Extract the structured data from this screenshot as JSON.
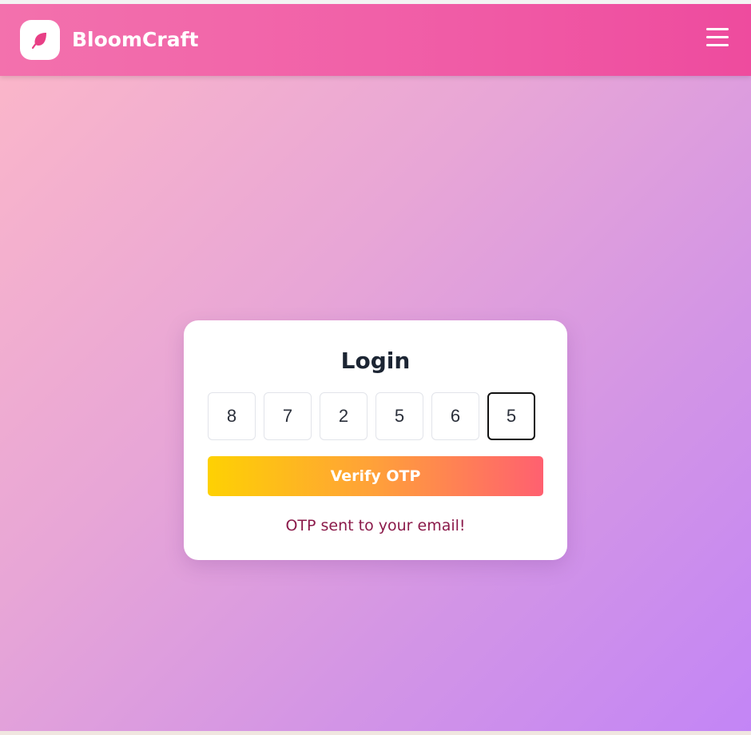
{
  "header": {
    "brand": "BloomCraft",
    "logo_icon": "leaf-icon",
    "menu_icon": "hamburger-menu-icon"
  },
  "login": {
    "title": "Login",
    "otp_digits": [
      "8",
      "7",
      "2",
      "5",
      "6",
      "5"
    ],
    "verify_label": "Verify OTP",
    "status_message": "OTP sent to your email!"
  },
  "colors": {
    "header_gradient": [
      "#f371ad",
      "#ee4b9e"
    ],
    "background_gradient": [
      "#fdb8c8",
      "#c385f6"
    ],
    "button_gradient": [
      "#fed103",
      "#ffa03a",
      "#ff6070"
    ],
    "logo_leaf": "#e83f86",
    "status_text": "#8b1a4a"
  }
}
